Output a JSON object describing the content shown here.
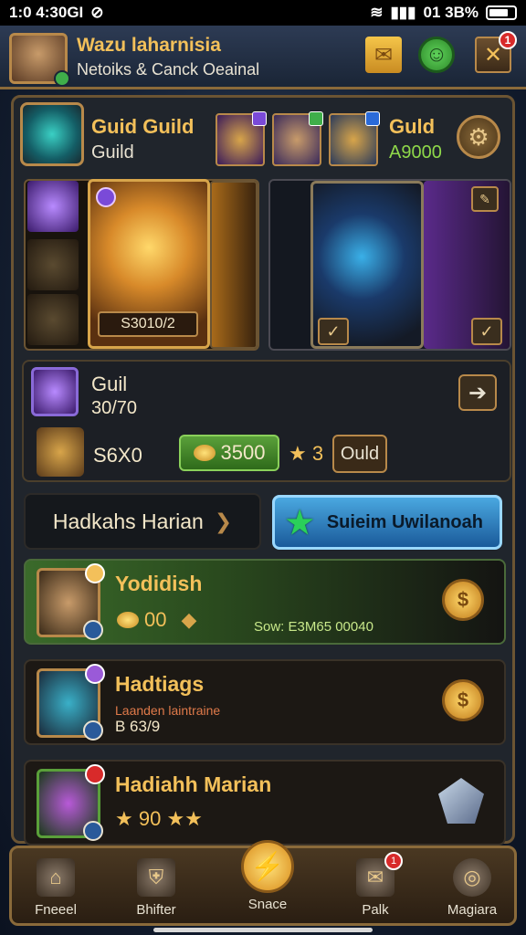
{
  "status_bar": {
    "time": "1:0 4:30GI",
    "battery": "01 3B%"
  },
  "header": {
    "title": "Wazu laharnisia",
    "subtitle": "Netoiks & Canck Oeainal",
    "close_badge": "1"
  },
  "guild_panel": {
    "title": "Guid Guild",
    "subtitle": "Guild",
    "right_name": "Guld",
    "right_power": "A9000"
  },
  "hero_card": {
    "price": "S3010/2"
  },
  "guild_row": {
    "title": "Guil",
    "number": "30/70",
    "cost": "S6X0",
    "buy_amount": "3500",
    "stars": "3",
    "small_button": "Ould"
  },
  "actions": {
    "left_label": "Hadkahs Harian",
    "right_label": "Suieim Uwilanoah"
  },
  "list": [
    {
      "name": "Yodidish",
      "amount": "00",
      "extra": "Sow: E3M65 00040"
    },
    {
      "name": "Hadtiags",
      "small": "Laanden laintraine",
      "code": "B 63/9"
    },
    {
      "name": "Hadiahh Marian",
      "stars_text": "90"
    }
  ],
  "bottom_nav": [
    {
      "label": "Fneeel"
    },
    {
      "label": "Bhifter"
    },
    {
      "label": "Snace"
    },
    {
      "label": "Palk",
      "badge": "1"
    },
    {
      "label": "Magiara"
    }
  ],
  "colors": {
    "gold": "#f3c05a",
    "frame": "#b8894a",
    "action_blue": "#4aa8e0",
    "highlight_green": "#3a6a2a"
  }
}
